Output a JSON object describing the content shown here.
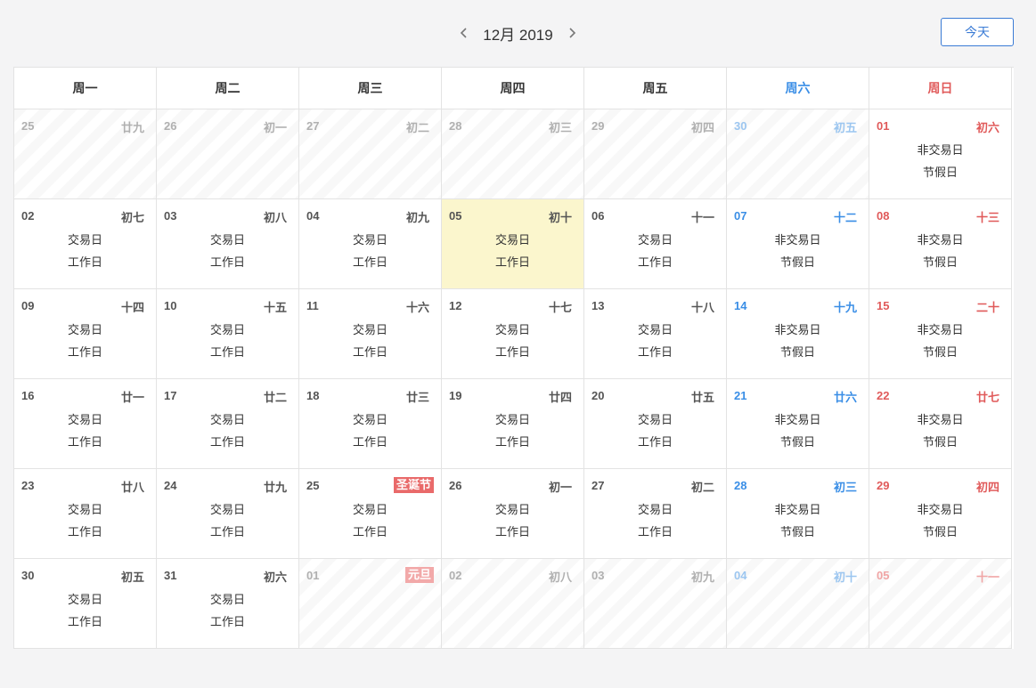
{
  "header": {
    "prev_icon": "chevron-left-icon",
    "next_icon": "chevron-right-icon",
    "month_label": "12月 2019",
    "today_label": "今天"
  },
  "colors": {
    "saturday": "#3a8ee6",
    "sunday": "#e05a5a",
    "today_highlight": "#fbf6cd",
    "festival": "#e96a6a",
    "accent": "#3a7bd5"
  },
  "weekdays": [
    "周一",
    "周二",
    "周三",
    "周四",
    "周五",
    "周六",
    "周日"
  ],
  "weeks": [
    [
      {
        "day": "25",
        "lunar": "廿九",
        "other": true
      },
      {
        "day": "26",
        "lunar": "初一",
        "other": true
      },
      {
        "day": "27",
        "lunar": "初二",
        "other": true
      },
      {
        "day": "28",
        "lunar": "初三",
        "other": true
      },
      {
        "day": "29",
        "lunar": "初四",
        "other": true
      },
      {
        "day": "30",
        "lunar": "初五",
        "other": true
      },
      {
        "day": "01",
        "lunar": "初六",
        "line1": "非交易日",
        "line2": "节假日"
      }
    ],
    [
      {
        "day": "02",
        "lunar": "初七",
        "line1": "交易日",
        "line2": "工作日"
      },
      {
        "day": "03",
        "lunar": "初八",
        "line1": "交易日",
        "line2": "工作日"
      },
      {
        "day": "04",
        "lunar": "初九",
        "line1": "交易日",
        "line2": "工作日"
      },
      {
        "day": "05",
        "lunar": "初十",
        "line1": "交易日",
        "line2": "工作日",
        "today": true
      },
      {
        "day": "06",
        "lunar": "十一",
        "line1": "交易日",
        "line2": "工作日"
      },
      {
        "day": "07",
        "lunar": "十二",
        "line1": "非交易日",
        "line2": "节假日"
      },
      {
        "day": "08",
        "lunar": "十三",
        "line1": "非交易日",
        "line2": "节假日"
      }
    ],
    [
      {
        "day": "09",
        "lunar": "十四",
        "line1": "交易日",
        "line2": "工作日"
      },
      {
        "day": "10",
        "lunar": "十五",
        "line1": "交易日",
        "line2": "工作日"
      },
      {
        "day": "11",
        "lunar": "十六",
        "line1": "交易日",
        "line2": "工作日"
      },
      {
        "day": "12",
        "lunar": "十七",
        "line1": "交易日",
        "line2": "工作日"
      },
      {
        "day": "13",
        "lunar": "十八",
        "line1": "交易日",
        "line2": "工作日"
      },
      {
        "day": "14",
        "lunar": "十九",
        "line1": "非交易日",
        "line2": "节假日"
      },
      {
        "day": "15",
        "lunar": "二十",
        "line1": "非交易日",
        "line2": "节假日"
      }
    ],
    [
      {
        "day": "16",
        "lunar": "廿一",
        "line1": "交易日",
        "line2": "工作日"
      },
      {
        "day": "17",
        "lunar": "廿二",
        "line1": "交易日",
        "line2": "工作日"
      },
      {
        "day": "18",
        "lunar": "廿三",
        "line1": "交易日",
        "line2": "工作日"
      },
      {
        "day": "19",
        "lunar": "廿四",
        "line1": "交易日",
        "line2": "工作日"
      },
      {
        "day": "20",
        "lunar": "廿五",
        "line1": "交易日",
        "line2": "工作日"
      },
      {
        "day": "21",
        "lunar": "廿六",
        "line1": "非交易日",
        "line2": "节假日"
      },
      {
        "day": "22",
        "lunar": "廿七",
        "line1": "非交易日",
        "line2": "节假日"
      }
    ],
    [
      {
        "day": "23",
        "lunar": "廿八",
        "line1": "交易日",
        "line2": "工作日"
      },
      {
        "day": "24",
        "lunar": "廿九",
        "line1": "交易日",
        "line2": "工作日"
      },
      {
        "day": "25",
        "festival": "圣诞节",
        "line1": "交易日",
        "line2": "工作日"
      },
      {
        "day": "26",
        "lunar": "初一",
        "line1": "交易日",
        "line2": "工作日"
      },
      {
        "day": "27",
        "lunar": "初二",
        "line1": "交易日",
        "line2": "工作日"
      },
      {
        "day": "28",
        "lunar": "初三",
        "line1": "非交易日",
        "line2": "节假日"
      },
      {
        "day": "29",
        "lunar": "初四",
        "line1": "非交易日",
        "line2": "节假日"
      }
    ],
    [
      {
        "day": "30",
        "lunar": "初五",
        "line1": "交易日",
        "line2": "工作日"
      },
      {
        "day": "31",
        "lunar": "初六",
        "line1": "交易日",
        "line2": "工作日"
      },
      {
        "day": "01",
        "festival": "元旦",
        "other": true
      },
      {
        "day": "02",
        "lunar": "初八",
        "other": true
      },
      {
        "day": "03",
        "lunar": "初九",
        "other": true
      },
      {
        "day": "04",
        "lunar": "初十",
        "other": true
      },
      {
        "day": "05",
        "lunar": "十一",
        "other": true
      }
    ]
  ]
}
